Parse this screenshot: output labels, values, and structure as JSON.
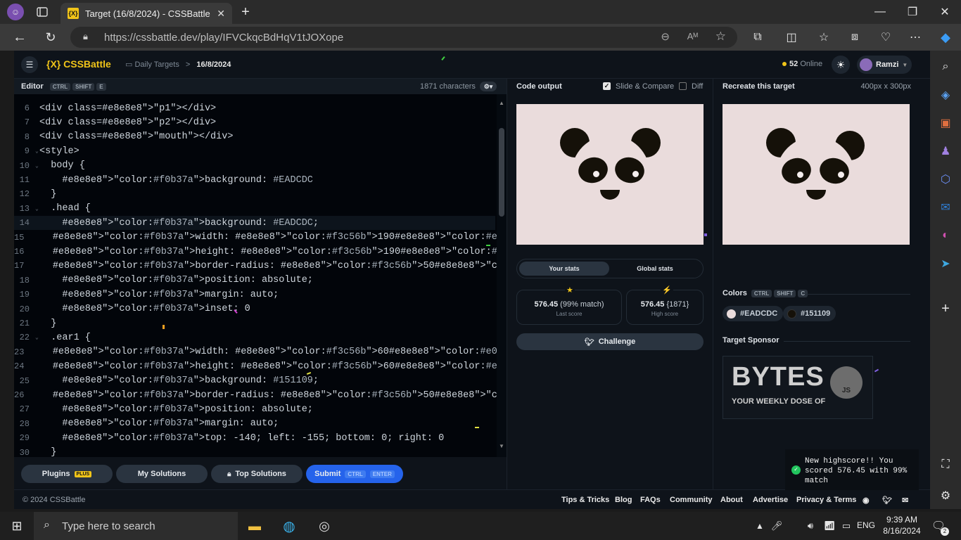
{
  "browser": {
    "tab_title": "Target (16/8/2024) - CSSBattle",
    "tab_icon": "{X}",
    "url": "https://cssbattle.dev/play/IFVCkqcBdHqV1tJOXope",
    "read_aloud_icon": "Aᴹ"
  },
  "nav": {
    "logo": "{X} CSSBattle",
    "crumb_parent": "Daily Targets",
    "crumb_sep": ">",
    "crumb_current": "16/8/2024",
    "online_count": "52",
    "online_label": "Online",
    "user": "Ramzi"
  },
  "editor": {
    "title": "Editor",
    "shortcut": [
      "CTRL",
      "SHIFT",
      "E"
    ],
    "char_count": "1871 characters",
    "lines": [
      {
        "n": "6",
        "fold": "",
        "text": "<div class=\"p1\"></div>"
      },
      {
        "n": "7",
        "fold": "",
        "text": "<div class=\"p2\"></div>"
      },
      {
        "n": "8",
        "fold": "",
        "text": "<div class=\"mouth\"></div>"
      },
      {
        "n": "9",
        "fold": "⌄",
        "text": "<style>"
      },
      {
        "n": "10",
        "fold": "⌄",
        "text": "  body {"
      },
      {
        "n": "11",
        "fold": "",
        "text": "    background: #EADCDC"
      },
      {
        "n": "12",
        "fold": "",
        "text": "  }"
      },
      {
        "n": "13",
        "fold": "⌄",
        "text": "  .head {"
      },
      {
        "n": "14",
        "fold": "",
        "text": "    background: #EADCDC;"
      },
      {
        "n": "15",
        "fold": "",
        "text": "    width: 190px;"
      },
      {
        "n": "16",
        "fold": "",
        "text": "    height: 190px;"
      },
      {
        "n": "17",
        "fold": "",
        "text": "    border-radius: 50%;"
      },
      {
        "n": "18",
        "fold": "",
        "text": "    position: absolute;"
      },
      {
        "n": "19",
        "fold": "",
        "text": "    margin: auto;"
      },
      {
        "n": "20",
        "fold": "",
        "text": "    inset: 0"
      },
      {
        "n": "21",
        "fold": "",
        "text": "  }"
      },
      {
        "n": "22",
        "fold": "⌄",
        "text": "  .ear1 {"
      },
      {
        "n": "23",
        "fold": "",
        "text": "    width: 60px;"
      },
      {
        "n": "24",
        "fold": "",
        "text": "    height: 60px;"
      },
      {
        "n": "25",
        "fold": "",
        "text": "    background: #151109;"
      },
      {
        "n": "26",
        "fold": "",
        "text": "    border-radius: 50%;"
      },
      {
        "n": "27",
        "fold": "",
        "text": "    position: absolute;"
      },
      {
        "n": "28",
        "fold": "",
        "text": "    margin: auto;"
      },
      {
        "n": "29",
        "fold": "",
        "text": "    top: -140; left: -155; bottom: 0; right: 0"
      },
      {
        "n": "30",
        "fold": "",
        "text": "  }"
      }
    ]
  },
  "buttons": {
    "plugins": "Plugins",
    "plugins_badge": "PLUS",
    "my_solutions": "My Solutions",
    "top_solutions": "Top Solutions",
    "submit": "Submit",
    "submit_keys": [
      "CTRL",
      "ENTER"
    ],
    "challenge": "Challenge"
  },
  "output": {
    "title": "Code output",
    "slide_compare": "Slide & Compare",
    "diff": "Diff",
    "tab_your": "Your stats",
    "tab_global": "Global stats",
    "last_score": "576.45",
    "last_match": "(99% match)",
    "last_label": "Last score",
    "high_score": "576.45",
    "high_chars": "{1871}",
    "high_label": "High score"
  },
  "target": {
    "title": "Recreate this target",
    "size": "400px x 300px",
    "colors_label": "Colors",
    "colors_keys": [
      "CTRL",
      "SHIFT",
      "C"
    ],
    "color1": "#EADCDC",
    "color2": "#151109",
    "sponsor_label": "Target Sponsor",
    "sponsor_big": "BYTES",
    "sponsor_small": "YOUR WEEKLY DOSE OF",
    "sponsor_js": "JS"
  },
  "footer": {
    "copyright": "© 2024 CSSBattle",
    "links": [
      "Tips & Tricks",
      "Blog",
      "FAQs",
      "Community",
      "About",
      "Advertise",
      "Privacy & Terms"
    ]
  },
  "toast": {
    "line1": "New highscore!! You",
    "line2": "scored 576.45 with 99%",
    "line3": "match"
  },
  "taskbar": {
    "search_placeholder": "Type here to search",
    "lang": "ENG",
    "time": "9:39 AM",
    "date": "8/16/2024",
    "notif_count": "2"
  },
  "colors": {
    "accent_yellow": "#F0C419",
    "submit_blue": "#2563EB",
    "panda_bg": "#EADCDC",
    "panda_dark": "#151109"
  }
}
